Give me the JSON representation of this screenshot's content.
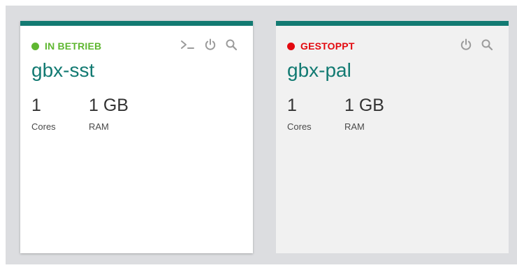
{
  "servers": [
    {
      "status_label": "IN BETRIEB",
      "status_color": "#5fb731",
      "name": "gbx-sst",
      "cores_value": "1",
      "cores_label": "Cores",
      "ram_value": "1 GB",
      "ram_label": "RAM",
      "actions": [
        "console-icon",
        "power-icon",
        "search-icon"
      ]
    },
    {
      "status_label": "GESTOPPT",
      "status_color": "#e3090f",
      "name": "gbx-pal",
      "cores_value": "1",
      "cores_label": "Cores",
      "ram_value": "1 GB",
      "ram_label": "RAM",
      "actions": [
        "power-icon",
        "search-icon"
      ]
    }
  ],
  "colors": {
    "accent": "#127a72",
    "icon": "#9b9b9b",
    "background": "#dcdde0"
  }
}
